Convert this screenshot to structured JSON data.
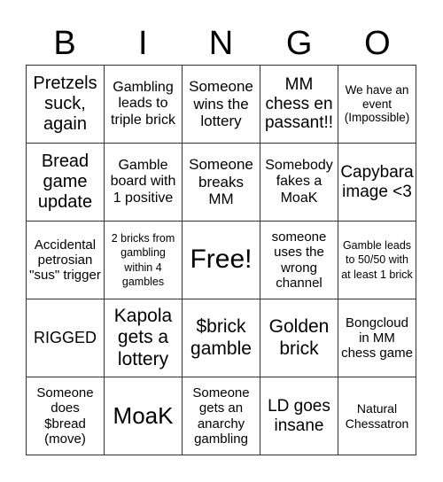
{
  "header": {
    "letters": [
      "B",
      "I",
      "N",
      "G",
      "O"
    ]
  },
  "cells": [
    {
      "text": "Pretzels suck, again",
      "size": "xl-19"
    },
    {
      "text": "Gambling leads to triple brick",
      "size": "m"
    },
    {
      "text": "Someone wins the lottery",
      "size": "m-l"
    },
    {
      "text": "MM chess en passant!!",
      "size": "l"
    },
    {
      "text": "We have an event (Impossible)",
      "size": "s"
    },
    {
      "text": "Bread game update",
      "size": "xl-19"
    },
    {
      "text": "Gamble board with 1 positive",
      "size": "m"
    },
    {
      "text": "Someone breaks MM",
      "size": "m-l"
    },
    {
      "text": "Somebody fakes a MoaK",
      "size": "m"
    },
    {
      "text": "Capybara image <3",
      "size": "l"
    },
    {
      "text": "Accidental petrosian \"sus\" trigger",
      "size": "m"
    },
    {
      "text": "2 bricks from gambling within 4 gambles",
      "size": "xs"
    },
    {
      "text": "Free!",
      "size": "xxl"
    },
    {
      "text": "someone uses the wrong channel",
      "size": "m"
    },
    {
      "text": "Gamble leads to 50/50 with at least 1 brick",
      "size": "xs"
    },
    {
      "text": "RIGGED",
      "size": "l"
    },
    {
      "text": "Kapola gets a lottery",
      "size": "xl"
    },
    {
      "text": "$brick gamble",
      "size": "xl"
    },
    {
      "text": "Golden brick",
      "size": "xl"
    },
    {
      "text": "Bongcloud in MM chess game",
      "size": "m"
    },
    {
      "text": "Someone does $bread (move)",
      "size": "m"
    },
    {
      "text": "MoaK",
      "size": "xxl"
    },
    {
      "text": "Someone gets an anarchy gambling",
      "size": "m"
    },
    {
      "text": "LD goes insane",
      "size": "xl"
    },
    {
      "text": "Natural Chessatron",
      "size": "s"
    }
  ]
}
